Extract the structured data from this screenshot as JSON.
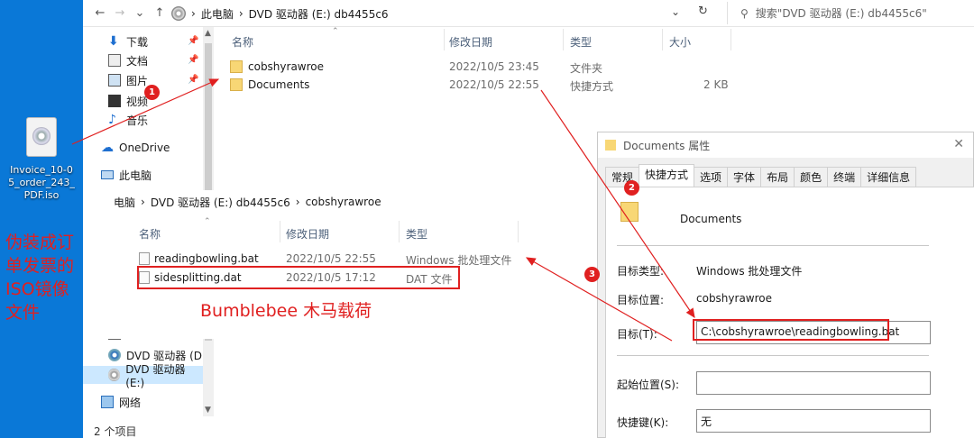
{
  "desktop": {
    "iso_label": "Invoice_10-05_order_243_PDF.iso",
    "note": "伪装成订单发票的ISO镜像文件"
  },
  "explorer": {
    "address": [
      "此电脑",
      "DVD 驱动器 (E:) db4455c6"
    ],
    "search_placeholder": "搜索\"DVD 驱动器 (E:) db4455c6\"",
    "nav": [
      {
        "label": "下载",
        "icon": "download-icon"
      },
      {
        "label": "文档",
        "icon": "documents-icon"
      },
      {
        "label": "图片",
        "icon": "pictures-icon"
      },
      {
        "label": "视频",
        "icon": "videos-icon"
      },
      {
        "label": "音乐",
        "icon": "music-icon"
      },
      {
        "label": "OneDrive",
        "icon": "cloud-icon"
      },
      {
        "label": "此电脑",
        "icon": "computer-icon"
      },
      {
        "label": "DVD 驱动器 (D:",
        "icon": "dvd-icon"
      },
      {
        "label": "DVD 驱动器 (E:)",
        "icon": "dvd-icon"
      },
      {
        "label": "网络",
        "icon": "network-icon"
      }
    ],
    "columns": {
      "name": "名称",
      "modified": "修改日期",
      "type": "类型",
      "size": "大小"
    },
    "files": [
      {
        "name": "cobshyrawroe",
        "modified": "2022/10/5 23:45",
        "type": "文件夹",
        "size": ""
      },
      {
        "name": "Documents",
        "modified": "2022/10/5 22:55",
        "type": "快捷方式",
        "size": "2 KB"
      }
    ],
    "status": "2 个项目"
  },
  "explorer2": {
    "address": [
      "电脑",
      "DVD 驱动器 (E:) db4455c6",
      "cobshyrawroe"
    ],
    "columns": {
      "name": "名称",
      "modified": "修改日期",
      "type": "类型"
    },
    "files": [
      {
        "name": "readingbowling.bat",
        "modified": "2022/10/5 22:55",
        "type": "Windows 批处理文件"
      },
      {
        "name": "sidesplitting.dat",
        "modified": "2022/10/5 17:12",
        "type": "DAT 文件"
      }
    ],
    "note": "Bumblebee 木马载荷"
  },
  "properties": {
    "title": "Documents 属性",
    "tabs": [
      "常规",
      "快捷方式",
      "选项",
      "字体",
      "布局",
      "颜色",
      "终端",
      "详细信息"
    ],
    "name": "Documents",
    "target_type_label": "目标类型:",
    "target_type": "Windows 批处理文件",
    "target_location_label": "目标位置:",
    "target_location": "cobshyrawroe",
    "target_label": "目标(T):",
    "target": "C:\\cobshyrawroe\\readingbowling.bat",
    "start_in_label": "起始位置(S):",
    "start_in": "",
    "hotkey_label": "快捷键(K):",
    "hotkey": "无"
  },
  "markers": [
    "1",
    "2",
    "3"
  ],
  "colors": {
    "annotation": "#e02020",
    "desktop": "#0a78d7"
  }
}
